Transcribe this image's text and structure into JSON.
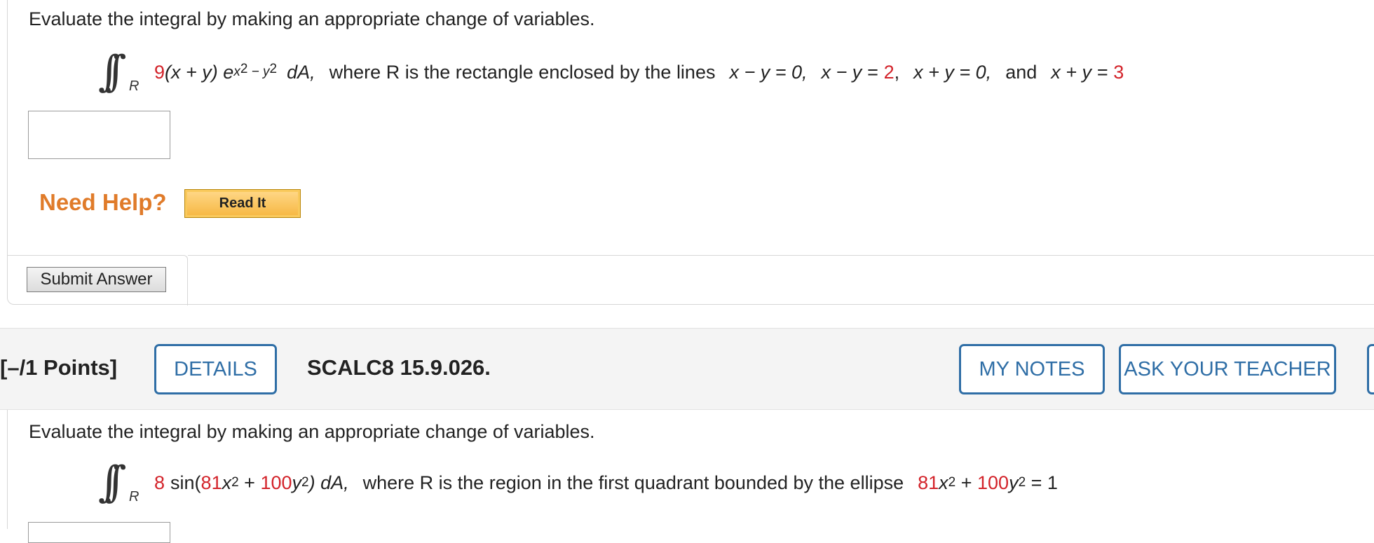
{
  "question1": {
    "prompt": "Evaluate the integral by making an appropriate change of variables.",
    "integral_sub": "R",
    "coef": "9",
    "expr_a": "(x + y) e",
    "exp_top": "x",
    "exp_sup2": "2",
    "exp_minus": " − y",
    "exp_sup2b": "2",
    "dA": "dA,",
    "where_text": "where R is the rectangle enclosed by the lines",
    "line1": "x − y = 0,",
    "line2_lhs": "x − y =",
    "line2_val": "2",
    "line2_comma": ",",
    "line3": "x + y = 0,",
    "and_text": "and",
    "line4_lhs": "x + y =",
    "line4_val": "3",
    "answer_value": "",
    "need_help": "Need Help?",
    "read_it": "Read It",
    "submit": "Submit Answer"
  },
  "question2_header": {
    "points": "[–/1 Points]",
    "details": "DETAILS",
    "code": "SCALC8 15.9.026.",
    "my_notes": "MY NOTES",
    "ask_teacher": "ASK YOUR TEACHER"
  },
  "question2": {
    "prompt": "Evaluate the integral by making an appropriate change of variables.",
    "integral_sub": "R",
    "coef": "8",
    "sin_open": "sin(",
    "a_coef": "81",
    "x_var": "x",
    "sup_a": "2",
    "plus": " + ",
    "b_coef": "100",
    "y_var": "y",
    "sup_b": "2",
    "close_dA": ") dA,",
    "where_text": "where R is the region in the first quadrant bounded by the ellipse",
    "e_a": "81",
    "e_x": "x",
    "e_sup_a": "2",
    "e_plus": " + ",
    "e_b": "100",
    "e_y": "y",
    "e_sup_b": "2",
    "e_eq": " = 1"
  },
  "colors": {
    "accent_blue": "#2f6ea6",
    "red_param": "#d3232a",
    "help_orange": "#e07b2a"
  }
}
